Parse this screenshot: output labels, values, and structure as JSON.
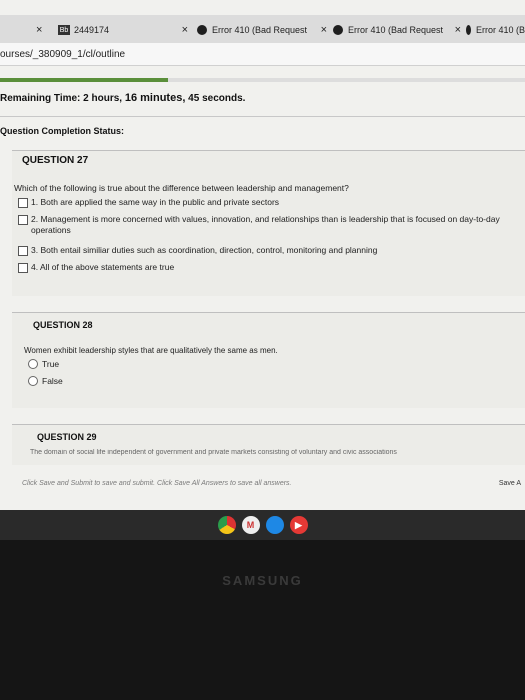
{
  "tabs": [
    {
      "label": "2449174",
      "icon": "blackboard-logo"
    },
    {
      "label": "Error 410 (Bad Request",
      "icon": "error-icon"
    },
    {
      "label": "Error 410 (Bad Request",
      "icon": "error-icon"
    },
    {
      "label": "Error 410 (B",
      "icon": "error-icon"
    }
  ],
  "bb_logo_text": "Bb",
  "close_glyph": "×",
  "url": "ourses/_380909_1/cl/outline",
  "progress_fraction": 0.32,
  "timer": {
    "label": "Remaining Time:",
    "hours": "2 hours,",
    "minutes": "16 minutes,",
    "seconds": "45 seconds."
  },
  "completion_status_label": "Question Completion Status:",
  "q27": {
    "heading": "QUESTION 27",
    "text": "Which of the following is true about the difference between leadership and management?",
    "options": [
      "1. Both are applied the same way in the public and private sectors",
      "2. Management is more concerned with values, innovation, and relationships than is leadership that is focused on day-to-day operations",
      "3. Both entail similiar duties such as coordination, direction, control, monitoring and planning",
      "4. All of the above statements are true"
    ]
  },
  "q28": {
    "heading": "QUESTION 28",
    "text": "Women exhibit leadership styles that are qualitatively the same as men.",
    "options": [
      "True",
      "False"
    ]
  },
  "q29": {
    "heading": "QUESTION 29",
    "text": "The domain of social life independent of government and private markets consisting of voluntary and civic associations"
  },
  "footer_note": "Click Save and Submit to save and submit. Click Save All Answers to save all answers.",
  "save_all_label": "Save A",
  "brand": "SAMSUNG",
  "colors": {
    "progress": "#5a8f3a",
    "background": "#f1f1ee"
  }
}
